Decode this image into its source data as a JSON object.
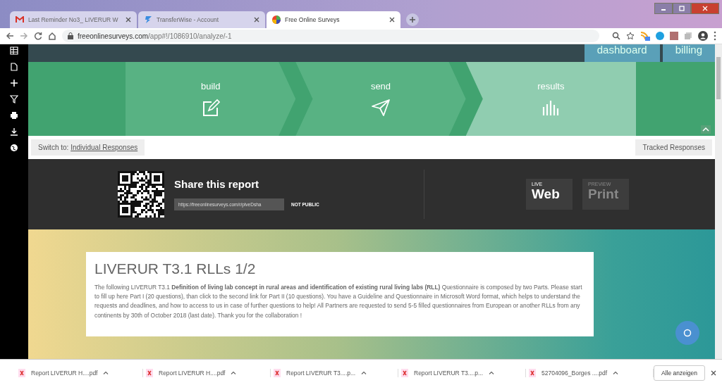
{
  "browser": {
    "tabs": [
      {
        "title": "Last Reminder No3_ LIVERUR W",
        "selected": false
      },
      {
        "title": "TransferWise - Account",
        "selected": false
      },
      {
        "title": "Free Online Surveys",
        "selected": true
      }
    ],
    "url_host": "freeonlinesurveys.com",
    "url_path": "/app#!/1086910/analyze/-1"
  },
  "app": {
    "top_links": [
      {
        "label": "dashboard"
      },
      {
        "label": "billing"
      }
    ],
    "steps": [
      {
        "label": "build",
        "selected": false
      },
      {
        "label": "send",
        "selected": false
      },
      {
        "label": "results",
        "selected": true
      }
    ],
    "switch_label": "Switch to:",
    "switch_link": "Individual Responses",
    "tracked": "Tracked Responses",
    "share": {
      "title": "Share this report",
      "link": "https://freeonlinesurveys.com/r/plveDsha",
      "visibility": "NOT PUBLIC",
      "modes": [
        {
          "small": "LIVE",
          "label": "Web",
          "selected": true
        },
        {
          "small": "PREVIEW",
          "label": "Print",
          "selected": false
        }
      ]
    },
    "survey": {
      "title": "LIVERUR T3.1 RLLs 1/2",
      "description": "The following LIVERUR T3.1 **Definition of living lab concept in rural areas and identification of existing rural living labs (RLL)** Questionnaire is composed by two Parts. Please start to fill up here Part I (20 questions), than click to the second link for Part II (10 questions). You have a Guideline and Questionnaire in Microsoft Word format, which helps to understand the requests and deadlines, and how to access to us in case of further questions to help! All Partners are requested to send 5-5 filled questionnaires from European or another RLLs from any continents by 30th of October 2018 (last date). Thank you for the collaboration !"
    }
  },
  "downloads": {
    "items": [
      {
        "name": "Report LIVERUR H....pdf"
      },
      {
        "name": "Report LIVERUR H....pdf"
      },
      {
        "name": "Report LIVERUR T3....p..."
      },
      {
        "name": "Report LIVERUR T3....p..."
      },
      {
        "name": "52704096_Borges ....pdf"
      }
    ],
    "show_all": "Alle anzeigen"
  }
}
